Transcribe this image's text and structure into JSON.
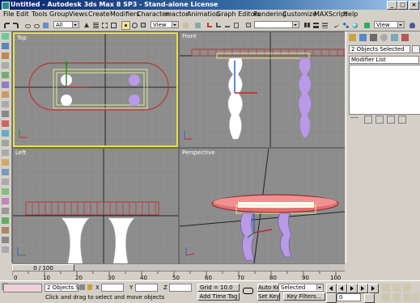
{
  "window": {
    "title": "Untitled  - Autodesk 3ds Max 8 SP3  - Stand-alone License",
    "controls": {
      "minimize": "_",
      "maximize": "□",
      "close": "×"
    }
  },
  "menu": [
    "File",
    "Edit",
    "Tools",
    "Group",
    "Views",
    "Create",
    "Modifiers",
    "Character",
    "reactor",
    "Animation",
    "Graph Editors",
    "Rendering",
    "Customize",
    "MAXScript",
    "Help"
  ],
  "toolbar": {
    "selection_filter": "All",
    "reference_coord": "View",
    "named_selection": "View"
  },
  "viewports": {
    "top": {
      "label": "Top"
    },
    "front": {
      "label": "Front"
    },
    "left": {
      "label": "Left"
    },
    "perspective": {
      "label": "Perspective"
    }
  },
  "command_panel": {
    "selection_name": "2 Objects Selected",
    "modifier_list": "Modifier List"
  },
  "timeline": {
    "frame_display": "0 / 100",
    "ticks": [
      "0",
      "10",
      "20",
      "30",
      "40",
      "50",
      "60",
      "70",
      "80",
      "90",
      "100"
    ]
  },
  "status": {
    "selection_count": "2 Objects Sel",
    "x_label": "X",
    "y_label": "Y",
    "z_label": "Z",
    "grid": "Grid = 10.0",
    "prompt": "Click and drag to select and move objects",
    "add_time_tag": "Add Time Tag",
    "auto_key": "Auto Key",
    "set_key": "Set Key",
    "key_mode": "Selected",
    "key_filters": "Key Filters...",
    "frame": "0"
  },
  "colors": {
    "title_gradient_start": "#0a246a",
    "active_viewport_border": "#e8e050",
    "viewport_bg": "#8c8c8c",
    "table_outline": "#c83030",
    "selection_box": "#e6e69a",
    "leg_purple": "#b89ae6"
  }
}
